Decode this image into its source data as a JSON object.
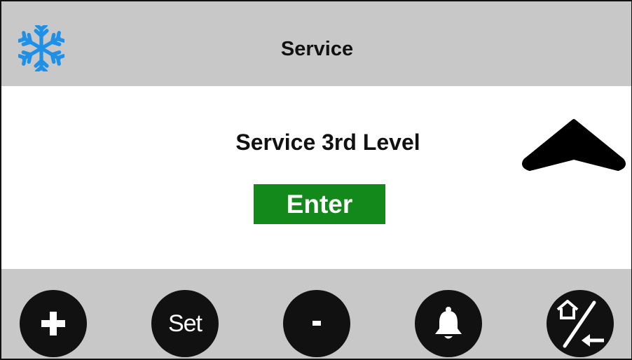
{
  "header": {
    "title": "Service",
    "icon": "snowflake-icon",
    "icon_color": "#1e90e8"
  },
  "main": {
    "level_label": "Service 3rd Level",
    "enter_label": "Enter",
    "enter_color": "#13891b",
    "up_icon": "chevron-up-icon"
  },
  "footer": {
    "buttons": [
      {
        "icon": "plus-icon"
      },
      {
        "label": "Set"
      },
      {
        "icon": "minus-icon"
      },
      {
        "icon": "bell-icon"
      },
      {
        "icon": "home-back-icon"
      }
    ]
  }
}
